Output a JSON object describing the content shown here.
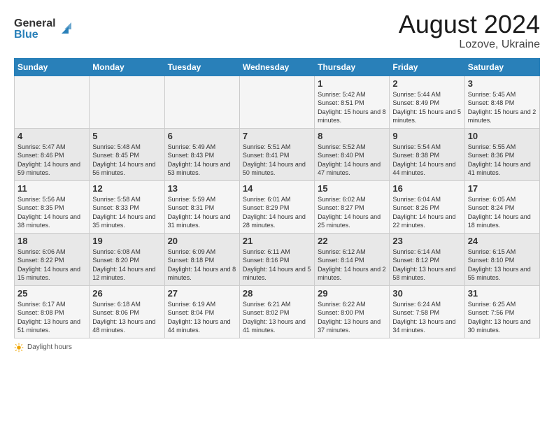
{
  "header": {
    "logo_line1": "General",
    "logo_line2": "Blue",
    "month_year": "August 2024",
    "location": "Lozove, Ukraine"
  },
  "days_of_week": [
    "Sunday",
    "Monday",
    "Tuesday",
    "Wednesday",
    "Thursday",
    "Friday",
    "Saturday"
  ],
  "footer": {
    "daylight_label": "Daylight hours"
  },
  "weeks": [
    [
      {
        "day": "",
        "sunrise": "",
        "sunset": "",
        "daylight": ""
      },
      {
        "day": "",
        "sunrise": "",
        "sunset": "",
        "daylight": ""
      },
      {
        "day": "",
        "sunrise": "",
        "sunset": "",
        "daylight": ""
      },
      {
        "day": "",
        "sunrise": "",
        "sunset": "",
        "daylight": ""
      },
      {
        "day": "1",
        "sunrise": "5:42 AM",
        "sunset": "8:51 PM",
        "daylight": "15 hours and 8 minutes."
      },
      {
        "day": "2",
        "sunrise": "5:44 AM",
        "sunset": "8:49 PM",
        "daylight": "15 hours and 5 minutes."
      },
      {
        "day": "3",
        "sunrise": "5:45 AM",
        "sunset": "8:48 PM",
        "daylight": "15 hours and 2 minutes."
      }
    ],
    [
      {
        "day": "4",
        "sunrise": "5:47 AM",
        "sunset": "8:46 PM",
        "daylight": "14 hours and 59 minutes."
      },
      {
        "day": "5",
        "sunrise": "5:48 AM",
        "sunset": "8:45 PM",
        "daylight": "14 hours and 56 minutes."
      },
      {
        "day": "6",
        "sunrise": "5:49 AM",
        "sunset": "8:43 PM",
        "daylight": "14 hours and 53 minutes."
      },
      {
        "day": "7",
        "sunrise": "5:51 AM",
        "sunset": "8:41 PM",
        "daylight": "14 hours and 50 minutes."
      },
      {
        "day": "8",
        "sunrise": "5:52 AM",
        "sunset": "8:40 PM",
        "daylight": "14 hours and 47 minutes."
      },
      {
        "day": "9",
        "sunrise": "5:54 AM",
        "sunset": "8:38 PM",
        "daylight": "14 hours and 44 minutes."
      },
      {
        "day": "10",
        "sunrise": "5:55 AM",
        "sunset": "8:36 PM",
        "daylight": "14 hours and 41 minutes."
      }
    ],
    [
      {
        "day": "11",
        "sunrise": "5:56 AM",
        "sunset": "8:35 PM",
        "daylight": "14 hours and 38 minutes."
      },
      {
        "day": "12",
        "sunrise": "5:58 AM",
        "sunset": "8:33 PM",
        "daylight": "14 hours and 35 minutes."
      },
      {
        "day": "13",
        "sunrise": "5:59 AM",
        "sunset": "8:31 PM",
        "daylight": "14 hours and 31 minutes."
      },
      {
        "day": "14",
        "sunrise": "6:01 AM",
        "sunset": "8:29 PM",
        "daylight": "14 hours and 28 minutes."
      },
      {
        "day": "15",
        "sunrise": "6:02 AM",
        "sunset": "8:27 PM",
        "daylight": "14 hours and 25 minutes."
      },
      {
        "day": "16",
        "sunrise": "6:04 AM",
        "sunset": "8:26 PM",
        "daylight": "14 hours and 22 minutes."
      },
      {
        "day": "17",
        "sunrise": "6:05 AM",
        "sunset": "8:24 PM",
        "daylight": "14 hours and 18 minutes."
      }
    ],
    [
      {
        "day": "18",
        "sunrise": "6:06 AM",
        "sunset": "8:22 PM",
        "daylight": "14 hours and 15 minutes."
      },
      {
        "day": "19",
        "sunrise": "6:08 AM",
        "sunset": "8:20 PM",
        "daylight": "14 hours and 12 minutes."
      },
      {
        "day": "20",
        "sunrise": "6:09 AM",
        "sunset": "8:18 PM",
        "daylight": "14 hours and 8 minutes."
      },
      {
        "day": "21",
        "sunrise": "6:11 AM",
        "sunset": "8:16 PM",
        "daylight": "14 hours and 5 minutes."
      },
      {
        "day": "22",
        "sunrise": "6:12 AM",
        "sunset": "8:14 PM",
        "daylight": "14 hours and 2 minutes."
      },
      {
        "day": "23",
        "sunrise": "6:14 AM",
        "sunset": "8:12 PM",
        "daylight": "13 hours and 58 minutes."
      },
      {
        "day": "24",
        "sunrise": "6:15 AM",
        "sunset": "8:10 PM",
        "daylight": "13 hours and 55 minutes."
      }
    ],
    [
      {
        "day": "25",
        "sunrise": "6:17 AM",
        "sunset": "8:08 PM",
        "daylight": "13 hours and 51 minutes."
      },
      {
        "day": "26",
        "sunrise": "6:18 AM",
        "sunset": "8:06 PM",
        "daylight": "13 hours and 48 minutes."
      },
      {
        "day": "27",
        "sunrise": "6:19 AM",
        "sunset": "8:04 PM",
        "daylight": "13 hours and 44 minutes."
      },
      {
        "day": "28",
        "sunrise": "6:21 AM",
        "sunset": "8:02 PM",
        "daylight": "13 hours and 41 minutes."
      },
      {
        "day": "29",
        "sunrise": "6:22 AM",
        "sunset": "8:00 PM",
        "daylight": "13 hours and 37 minutes."
      },
      {
        "day": "30",
        "sunrise": "6:24 AM",
        "sunset": "7:58 PM",
        "daylight": "13 hours and 34 minutes."
      },
      {
        "day": "31",
        "sunrise": "6:25 AM",
        "sunset": "7:56 PM",
        "daylight": "13 hours and 30 minutes."
      }
    ]
  ]
}
